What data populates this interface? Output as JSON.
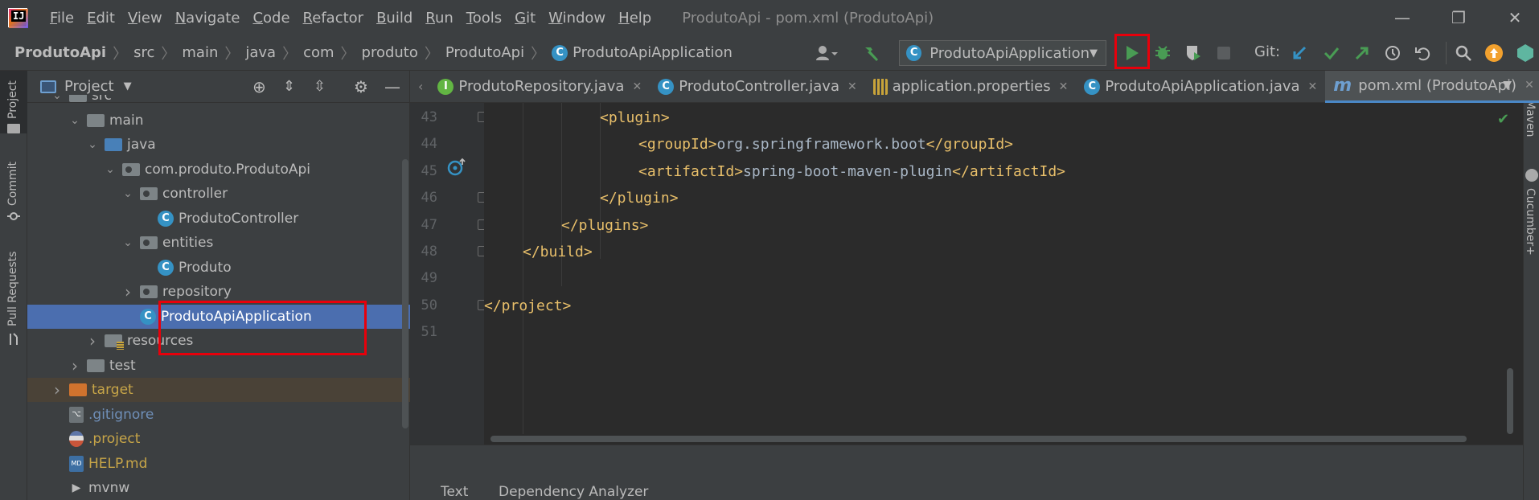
{
  "app": {
    "logo_text": "IJ"
  },
  "menu": [
    {
      "label": "File",
      "u": "F",
      "rest": "ile"
    },
    {
      "label": "Edit",
      "u": "E",
      "rest": "dit"
    },
    {
      "label": "View",
      "u": "V",
      "rest": "iew"
    },
    {
      "label": "Navigate",
      "u": "N",
      "rest": "avigate"
    },
    {
      "label": "Code",
      "u": "C",
      "rest": "ode"
    },
    {
      "label": "Refactor",
      "u": "R",
      "rest": "efactor"
    },
    {
      "label": "Build",
      "u": "B",
      "rest": "uild"
    },
    {
      "label": "Run",
      "u": "R",
      "rest": "un"
    },
    {
      "label": "Tools",
      "u": "T",
      "rest": "ools"
    },
    {
      "label": "Git",
      "u": "G",
      "rest": "it"
    },
    {
      "label": "Window",
      "u": "W",
      "rest": "indow"
    },
    {
      "label": "Help",
      "u": "H",
      "rest": "elp"
    }
  ],
  "window_title": "ProdutoApi - pom.xml (ProdutoApi)",
  "breadcrumbs": [
    "ProdutoApi",
    "src",
    "main",
    "java",
    "com",
    "produto",
    "ProdutoApi",
    "ProdutoApiApplication"
  ],
  "run_config": "ProdutoApiApplication",
  "git_label": "Git:",
  "left_stripe": {
    "project": "Project",
    "commit": "Commit",
    "pull_requests": "Pull Requests"
  },
  "right_stripe": {
    "maven": "Maven",
    "cucumber": "Cucumber+"
  },
  "project_panel": {
    "title": "Project"
  },
  "tree": [
    {
      "label": "src",
      "kind": "folder",
      "depth": 1,
      "chev": "v"
    },
    {
      "label": "main",
      "kind": "folder",
      "depth": 2,
      "chev": "v"
    },
    {
      "label": "java",
      "kind": "folder-blue",
      "depth": 3,
      "chev": "v"
    },
    {
      "label": "com.produto.ProdutoApi",
      "kind": "pkg",
      "depth": 4,
      "chev": "v"
    },
    {
      "label": "controller",
      "kind": "pkg",
      "depth": 5,
      "chev": "v"
    },
    {
      "label": "ProdutoController",
      "kind": "class",
      "depth": 6,
      "chev": ""
    },
    {
      "label": "entities",
      "kind": "pkg",
      "depth": 5,
      "chev": "v"
    },
    {
      "label": "Produto",
      "kind": "class",
      "depth": 6,
      "chev": ""
    },
    {
      "label": "repository",
      "kind": "pkg",
      "depth": 5,
      "chev": ">"
    },
    {
      "label": "ProdutoApiApplication",
      "kind": "class-run",
      "depth": 5,
      "chev": "",
      "selected": true
    },
    {
      "label": "resources",
      "kind": "folder-res",
      "depth": 3,
      "chev": ">"
    },
    {
      "label": "test",
      "kind": "folder",
      "depth": 2,
      "chev": ">"
    },
    {
      "label": "target",
      "kind": "folder-orange",
      "depth": 1,
      "chev": ">",
      "target": true
    },
    {
      "label": ".gitignore",
      "kind": "file-git",
      "depth": 1,
      "chev": ""
    },
    {
      "label": ".project",
      "kind": "file-proj",
      "depth": 1,
      "chev": ""
    },
    {
      "label": "HELP.md",
      "kind": "file-md",
      "depth": 1,
      "chev": ""
    },
    {
      "label": "mvnw",
      "kind": "file-sh",
      "depth": 1,
      "chev": ""
    }
  ],
  "tabs": [
    {
      "label": "ProdutoRepository.java",
      "icon": "interface",
      "active": false
    },
    {
      "label": "ProdutoController.java",
      "icon": "class",
      "active": false
    },
    {
      "label": "application.properties",
      "icon": "props",
      "active": false
    },
    {
      "label": "ProdutoApiApplication.java",
      "icon": "class-run",
      "active": false
    },
    {
      "label": "pom.xml (ProdutoApi)",
      "icon": "maven",
      "active": true
    }
  ],
  "code_lines": [
    {
      "n": "43",
      "indent": 3,
      "segs": [
        [
          "tg",
          "<plugin>"
        ]
      ]
    },
    {
      "n": "44",
      "indent": 4,
      "segs": [
        [
          "tg",
          "<groupId>"
        ],
        [
          "tx",
          "org.springframework.boot"
        ],
        [
          "tg",
          "</groupId>"
        ]
      ]
    },
    {
      "n": "45",
      "indent": 4,
      "segs": [
        [
          "tg",
          "<artifactId>"
        ],
        [
          "tx",
          "spring-boot-maven-plugin"
        ],
        [
          "tg",
          "</artifactId>"
        ]
      ]
    },
    {
      "n": "46",
      "indent": 3,
      "segs": [
        [
          "tg",
          "</plugin>"
        ]
      ]
    },
    {
      "n": "47",
      "indent": 2,
      "segs": [
        [
          "tg",
          "</plugins>"
        ]
      ]
    },
    {
      "n": "48",
      "indent": 1,
      "segs": [
        [
          "tg",
          "</build>"
        ]
      ]
    },
    {
      "n": "49",
      "indent": 0,
      "segs": []
    },
    {
      "n": "50",
      "indent": 0,
      "segs": [
        [
          "tg",
          "</project>"
        ]
      ]
    },
    {
      "n": "51",
      "indent": 0,
      "segs": []
    }
  ],
  "bottom_tabs": [
    "Text",
    "Dependency Analyzer"
  ],
  "colors": {
    "run_green": "#499c54",
    "highlight_red": "#e8000b",
    "selection": "#4b6eaf"
  }
}
